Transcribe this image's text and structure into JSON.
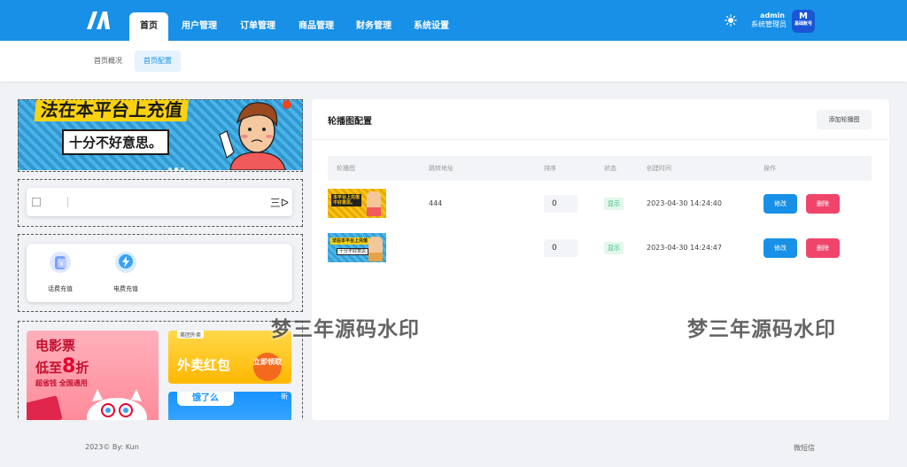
{
  "topnav": {
    "logo_icon": "brand-logo-icon",
    "items": [
      "首页",
      "用户管理",
      "订单管理",
      "商品管理",
      "财务管理",
      "系统设置"
    ],
    "active_index": 0,
    "theme_icon": "sun-icon",
    "user": {
      "name": "admin",
      "role": "系统管理员",
      "avatar_text": "M",
      "avatar_sub": "基础账号"
    }
  },
  "subnav": {
    "items": [
      "首页概况",
      "首页配置"
    ],
    "active_index": 1
  },
  "preview": {
    "banner": {
      "headline": "法在本平台上充值",
      "sub": "十分不好意思。"
    },
    "search": {
      "menu_glyph": "三ᐅ"
    },
    "tools": [
      {
        "label": "话费充值",
        "icon": "phone-recharge-icon"
      },
      {
        "label": "电费充值",
        "icon": "electricity-recharge-icon"
      }
    ],
    "ads": {
      "movie": {
        "line1": "电影票",
        "line2_prefix": "低至",
        "line2_num": "8",
        "line2_suffix": "折",
        "line3": "超省钱 全国通用"
      },
      "food": {
        "tag": "美团外卖",
        "title": "外卖红包",
        "button": "立即领取"
      },
      "ele": {
        "logo": "饿了么",
        "badge": "新"
      }
    }
  },
  "panel": {
    "title": "轮播图配置",
    "add_button": "添加轮播图",
    "headers": [
      "轮播图",
      "跳转地址",
      "排序",
      "状态",
      "创建时间",
      "操作"
    ],
    "rows": [
      {
        "link": "444",
        "sort": "0",
        "status": "显示",
        "time": "2023-04-30 14:24:40",
        "edit": "修改",
        "delete": "删除"
      },
      {
        "link": "",
        "sort": "0",
        "status": "显示",
        "time": "2023-04-30 14:24:47",
        "edit": "修改",
        "delete": "删除"
      }
    ]
  },
  "watermark": "梦三年源码水印",
  "footer": {
    "copyright": "2023© By: Kun",
    "right_text": "微短信"
  },
  "colors": {
    "primary": "#1890e8",
    "danger": "#f0456b",
    "success": "#2eb872"
  }
}
